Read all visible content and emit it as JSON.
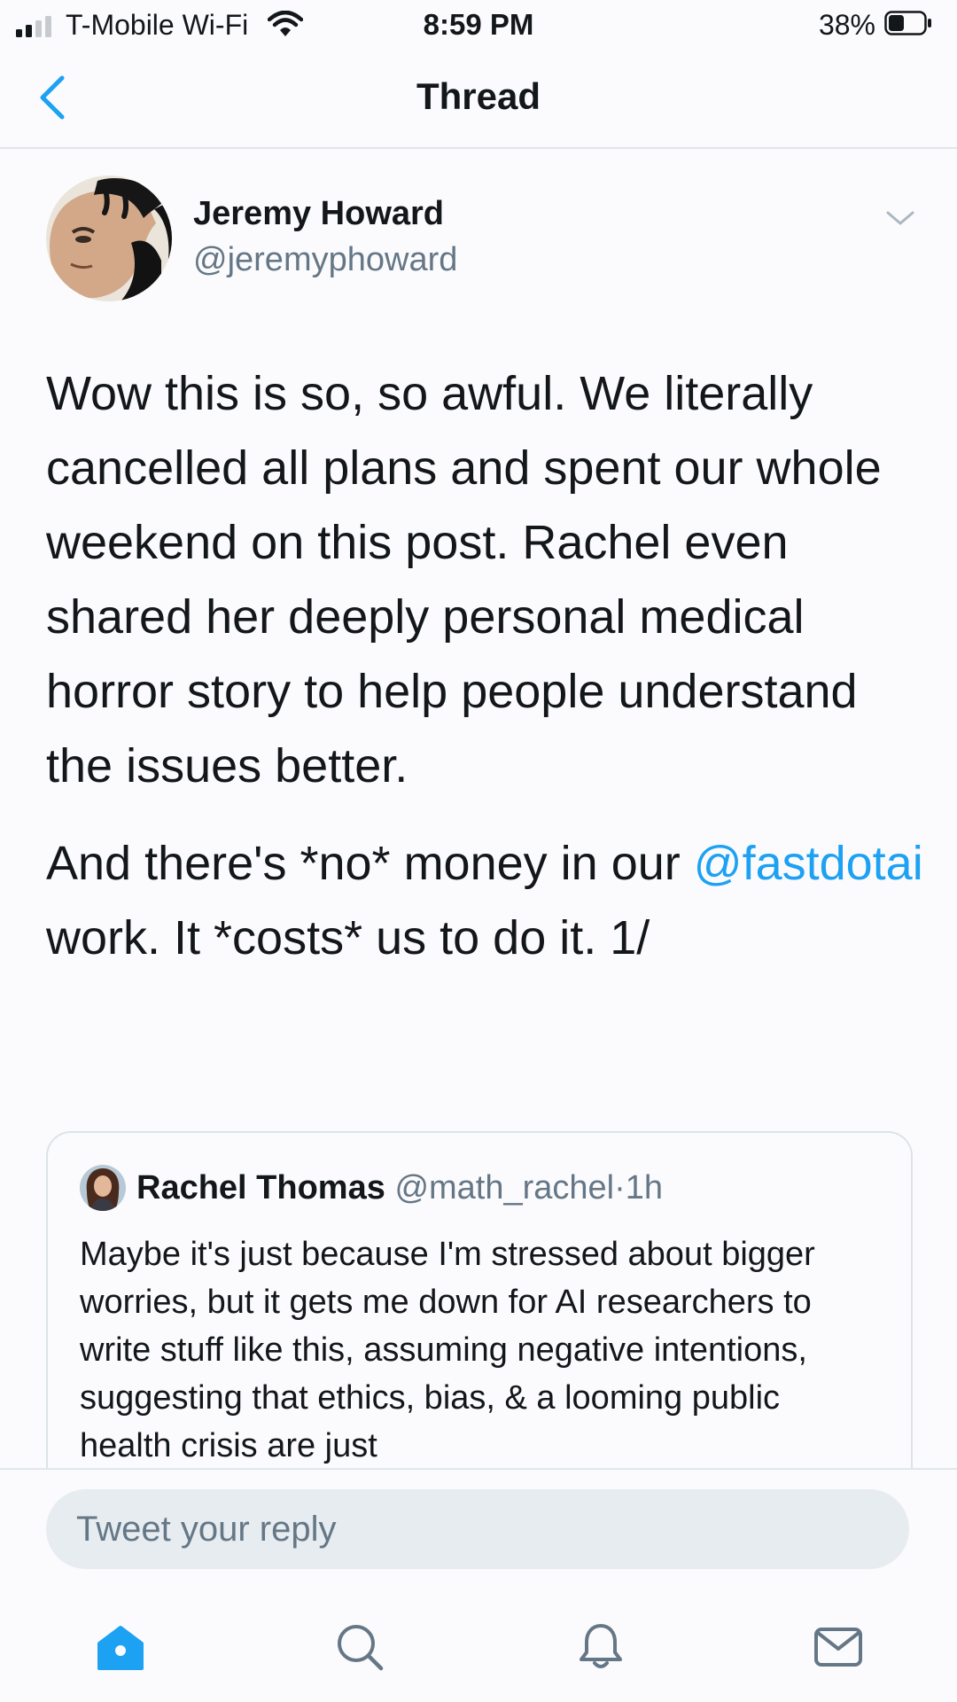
{
  "status_bar": {
    "carrier": "T-Mobile Wi-Fi",
    "time": "8:59 PM",
    "battery": "38%"
  },
  "header": {
    "title": "Thread"
  },
  "tweet": {
    "author_name": "Jeremy Howard",
    "author_handle": "@jeremyphoward",
    "paragraph1": "Wow this is so, so awful. We literally cancelled all plans and spent our whole weekend on this post. Rachel even shared her deeply personal medical horror story to help people understand the issues better.",
    "paragraph2_prefix": "And there's *no* money in our ",
    "mention": "@fastdotai",
    "paragraph2_suffix": " work. It *costs* us to do it. 1/"
  },
  "quoted_tweet": {
    "author_name": "Rachel Thomas",
    "author_handle": "@math_rachel",
    "separator": "·",
    "time": "1h",
    "text": "Maybe it's just because I'm stressed about bigger worries, but it gets me down for AI researchers to write stuff like this, assuming negative intentions, suggesting that ethics, bias, & a looming public health crisis are just"
  },
  "reply": {
    "placeholder": "Tweet your reply"
  },
  "tab_bar": {
    "items": [
      "home-icon",
      "search-icon",
      "notifications-icon",
      "messages-icon"
    ],
    "active": "home"
  },
  "colors": {
    "accent": "#1da1f2",
    "text": "#14171a",
    "secondary": "#657786"
  }
}
